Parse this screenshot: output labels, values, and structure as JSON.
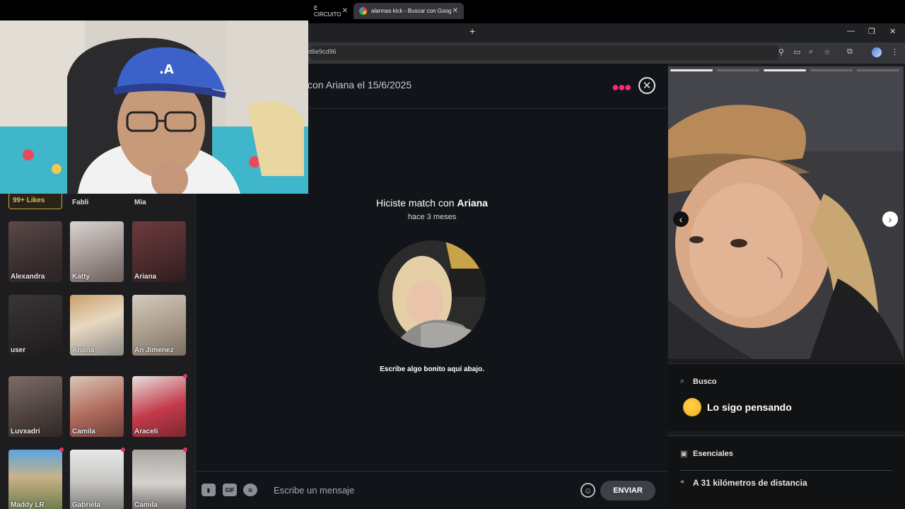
{
  "browser": {
    "tabs": [
      {
        "title": "E CIRCUITO",
        "active": false
      },
      {
        "title": "alarmas kick - Buscar con Goog",
        "active": true
      }
    ],
    "url_fragment": "d6e9cd96"
  },
  "matches_grid": {
    "likes_badge": "99+ Likes",
    "partial_names": [
      "Fabli",
      "Mia"
    ],
    "cards": [
      {
        "name": "Alexandra",
        "unread": false
      },
      {
        "name": "Katty",
        "unread": false
      },
      {
        "name": "Ariana",
        "unread": false
      },
      {
        "name": "user",
        "unread": false
      },
      {
        "name": "Ariana",
        "unread": false,
        "selected": true
      },
      {
        "name": "An Jimenez",
        "unread": false
      },
      {
        "name": "Luvxadri",
        "unread": false
      },
      {
        "name": "Camila",
        "unread": false
      },
      {
        "name": "Araceli",
        "unread": true
      },
      {
        "name": "Maddy LR",
        "unread": true
      },
      {
        "name": "Gabriela",
        "unread": true
      },
      {
        "name": "Camila",
        "unread": true
      }
    ]
  },
  "chat": {
    "header_title": "con Ariana el 15/6/2025",
    "match_prefix": "Hiciste match con ",
    "match_name": "Ariana",
    "match_time": "hace 3 meses",
    "hint": "Escribe algo bonito aquí abajo.",
    "composer_placeholder": "Escribe un mensaje",
    "gif_label": "GIF",
    "send_label": "ENVIAR"
  },
  "profile": {
    "photo_count": 5,
    "looking_for_label": "Busco",
    "looking_for_value": "Lo sigo pensando",
    "essentials_label": "Esenciales",
    "distance": "A 31 kilómetros de distancia"
  },
  "colors": {
    "accent": "#fd267d",
    "background": "#111418",
    "panel": "#1b1c1f",
    "likes_gold": "#c9a34a"
  }
}
